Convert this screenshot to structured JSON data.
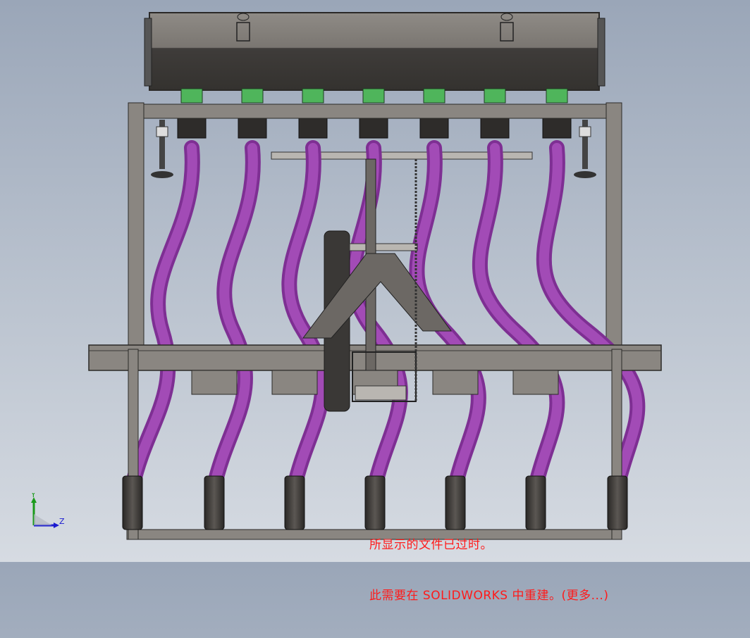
{
  "colors": {
    "frame": "#7e7a75",
    "frame_dark": "#5a5653",
    "hopper": "#6f6b66",
    "tube": "#a24bb6",
    "tube_dark": "#7e2f93",
    "meter": "#4fb55b",
    "warning_text": "#ff1a1a"
  },
  "warning": {
    "line1": "所显示的文件已过时。",
    "line2": "此需要在 SOLIDWORKS 中重建。(更多...)"
  },
  "triad": {
    "y_label": "Y",
    "z_label": "Z"
  }
}
